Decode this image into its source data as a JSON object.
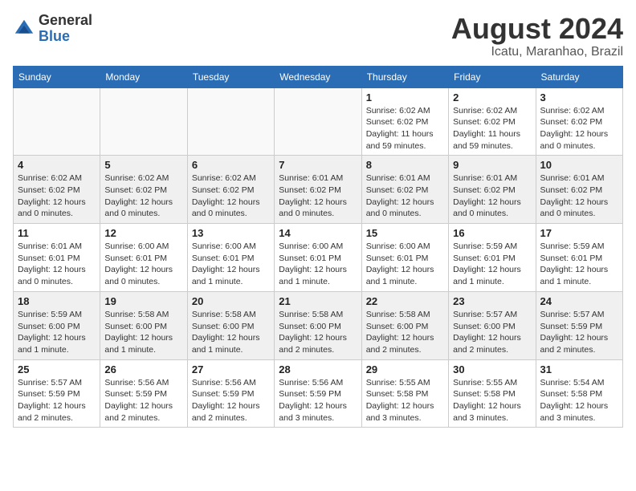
{
  "header": {
    "logo": {
      "general": "General",
      "blue": "Blue",
      "tagline": ""
    },
    "title": "August 2024",
    "location": "Icatu, Maranhao, Brazil"
  },
  "calendar": {
    "days_of_week": [
      "Sunday",
      "Monday",
      "Tuesday",
      "Wednesday",
      "Thursday",
      "Friday",
      "Saturday"
    ],
    "weeks": [
      [
        {
          "day": "",
          "info": ""
        },
        {
          "day": "",
          "info": ""
        },
        {
          "day": "",
          "info": ""
        },
        {
          "day": "",
          "info": ""
        },
        {
          "day": "1",
          "info": "Sunrise: 6:02 AM\nSunset: 6:02 PM\nDaylight: 11 hours\nand 59 minutes."
        },
        {
          "day": "2",
          "info": "Sunrise: 6:02 AM\nSunset: 6:02 PM\nDaylight: 11 hours\nand 59 minutes."
        },
        {
          "day": "3",
          "info": "Sunrise: 6:02 AM\nSunset: 6:02 PM\nDaylight: 12 hours\nand 0 minutes."
        }
      ],
      [
        {
          "day": "4",
          "info": "Sunrise: 6:02 AM\nSunset: 6:02 PM\nDaylight: 12 hours\nand 0 minutes."
        },
        {
          "day": "5",
          "info": "Sunrise: 6:02 AM\nSunset: 6:02 PM\nDaylight: 12 hours\nand 0 minutes."
        },
        {
          "day": "6",
          "info": "Sunrise: 6:02 AM\nSunset: 6:02 PM\nDaylight: 12 hours\nand 0 minutes."
        },
        {
          "day": "7",
          "info": "Sunrise: 6:01 AM\nSunset: 6:02 PM\nDaylight: 12 hours\nand 0 minutes."
        },
        {
          "day": "8",
          "info": "Sunrise: 6:01 AM\nSunset: 6:02 PM\nDaylight: 12 hours\nand 0 minutes."
        },
        {
          "day": "9",
          "info": "Sunrise: 6:01 AM\nSunset: 6:02 PM\nDaylight: 12 hours\nand 0 minutes."
        },
        {
          "day": "10",
          "info": "Sunrise: 6:01 AM\nSunset: 6:02 PM\nDaylight: 12 hours\nand 0 minutes."
        }
      ],
      [
        {
          "day": "11",
          "info": "Sunrise: 6:01 AM\nSunset: 6:01 PM\nDaylight: 12 hours\nand 0 minutes."
        },
        {
          "day": "12",
          "info": "Sunrise: 6:00 AM\nSunset: 6:01 PM\nDaylight: 12 hours\nand 0 minutes."
        },
        {
          "day": "13",
          "info": "Sunrise: 6:00 AM\nSunset: 6:01 PM\nDaylight: 12 hours\nand 1 minute."
        },
        {
          "day": "14",
          "info": "Sunrise: 6:00 AM\nSunset: 6:01 PM\nDaylight: 12 hours\nand 1 minute."
        },
        {
          "day": "15",
          "info": "Sunrise: 6:00 AM\nSunset: 6:01 PM\nDaylight: 12 hours\nand 1 minute."
        },
        {
          "day": "16",
          "info": "Sunrise: 5:59 AM\nSunset: 6:01 PM\nDaylight: 12 hours\nand 1 minute."
        },
        {
          "day": "17",
          "info": "Sunrise: 5:59 AM\nSunset: 6:01 PM\nDaylight: 12 hours\nand 1 minute."
        }
      ],
      [
        {
          "day": "18",
          "info": "Sunrise: 5:59 AM\nSunset: 6:00 PM\nDaylight: 12 hours\nand 1 minute."
        },
        {
          "day": "19",
          "info": "Sunrise: 5:58 AM\nSunset: 6:00 PM\nDaylight: 12 hours\nand 1 minute."
        },
        {
          "day": "20",
          "info": "Sunrise: 5:58 AM\nSunset: 6:00 PM\nDaylight: 12 hours\nand 1 minute."
        },
        {
          "day": "21",
          "info": "Sunrise: 5:58 AM\nSunset: 6:00 PM\nDaylight: 12 hours\nand 2 minutes."
        },
        {
          "day": "22",
          "info": "Sunrise: 5:58 AM\nSunset: 6:00 PM\nDaylight: 12 hours\nand 2 minutes."
        },
        {
          "day": "23",
          "info": "Sunrise: 5:57 AM\nSunset: 6:00 PM\nDaylight: 12 hours\nand 2 minutes."
        },
        {
          "day": "24",
          "info": "Sunrise: 5:57 AM\nSunset: 5:59 PM\nDaylight: 12 hours\nand 2 minutes."
        }
      ],
      [
        {
          "day": "25",
          "info": "Sunrise: 5:57 AM\nSunset: 5:59 PM\nDaylight: 12 hours\nand 2 minutes."
        },
        {
          "day": "26",
          "info": "Sunrise: 5:56 AM\nSunset: 5:59 PM\nDaylight: 12 hours\nand 2 minutes."
        },
        {
          "day": "27",
          "info": "Sunrise: 5:56 AM\nSunset: 5:59 PM\nDaylight: 12 hours\nand 2 minutes."
        },
        {
          "day": "28",
          "info": "Sunrise: 5:56 AM\nSunset: 5:59 PM\nDaylight: 12 hours\nand 3 minutes."
        },
        {
          "day": "29",
          "info": "Sunrise: 5:55 AM\nSunset: 5:58 PM\nDaylight: 12 hours\nand 3 minutes."
        },
        {
          "day": "30",
          "info": "Sunrise: 5:55 AM\nSunset: 5:58 PM\nDaylight: 12 hours\nand 3 minutes."
        },
        {
          "day": "31",
          "info": "Sunrise: 5:54 AM\nSunset: 5:58 PM\nDaylight: 12 hours\nand 3 minutes."
        }
      ]
    ]
  }
}
